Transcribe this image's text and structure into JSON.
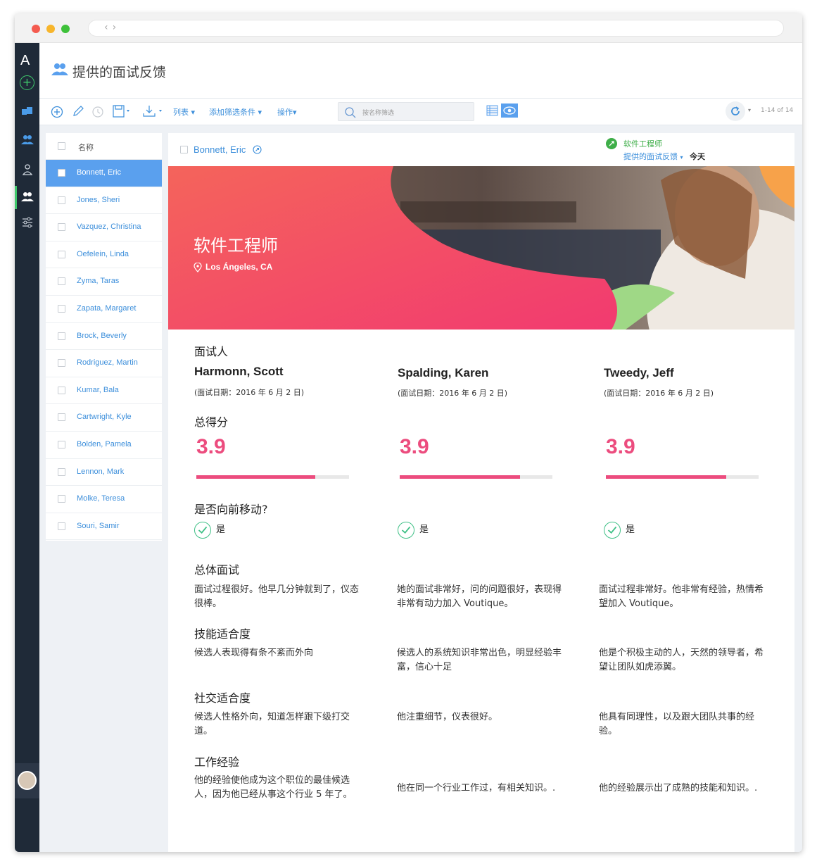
{
  "header": {
    "title": "提供的面试反馈"
  },
  "toolbar": {
    "list_label": "列表",
    "add_filter_label": "添加筛选条件",
    "actions_label": "操作",
    "search_placeholder": "按名称筛选",
    "pager": "1-14 of 14"
  },
  "list": {
    "header_label": "名称",
    "items": [
      "Bonnett, Eric",
      "Jones, Sheri",
      "Vazquez, Christina",
      "Oefelein, Linda",
      "Zyma, Taras",
      "Zapata, Margaret",
      "Brock, Beverly",
      "Rodriguez, Martin",
      "Kumar, Bala",
      "Cartwright, Kyle",
      "Bolden, Pamela",
      "Lennon, Mark",
      "Molke, Teresa",
      "Souri, Samir"
    ],
    "selected": "Bonnett, Eric"
  },
  "detail": {
    "candidate": "Bonnett, Eric",
    "job_link": "软件工程师",
    "feedback_link": "提供的面试反馈",
    "when": "今天",
    "banner_title": "软件工程师",
    "location": "Los Ángeles, CA",
    "section_interviewer": "面试人",
    "section_score": "总得分",
    "section_move": "是否向前移动?",
    "section_overall": "总体面试",
    "section_skills": "技能适合度",
    "section_social": "社交适合度",
    "section_experience": "工作经验",
    "interviewers": [
      {
        "name": "Harmonn, Scott",
        "date": "(面试日期：2016 年 6 月 2 日)",
        "score": "3.9",
        "score_fraction": 0.78,
        "move": "是",
        "overall": "面试过程很好。他早几分钟就到了，仪态很棒。",
        "skills": "候选人表现得有条不紊而外向",
        "social": "候选人性格外向，知道怎样跟下级打交道。",
        "experience": "他的经验使他成为这个职位的最佳候选人，因为他已经从事这个行业 5 年了。"
      },
      {
        "name": "Spalding, Karen",
        "date": "(面试日期：2016 年 6 月 2 日)",
        "score": "3.9",
        "score_fraction": 0.79,
        "move": "是",
        "overall": "她的面试非常好，问的问题很好，表现得非常有动力加入 Voutique。",
        "skills": "候选人的系统知识非常出色，明显经验丰富，信心十足",
        "social": "他注重细节，仪表很好。",
        "experience": "他在同一个行业工作过，有相关知识。."
      },
      {
        "name": "Tweedy, Jeff",
        "date": "(面试日期：2016 年 6 月 2 日)",
        "score": "3.9",
        "score_fraction": 0.79,
        "move": "是",
        "overall": "面试过程非常好。他非常有经验，热情希望加入 Voutique。",
        "skills": "他是个积极主动的人，天然的领导者，希望让团队如虎添翼。",
        "social": "他具有同理性，以及跟大团队共事的经验。",
        "experience": "他的经验展示出了成熟的技能和知识。."
      }
    ]
  },
  "colors": {
    "accent": "#3d8fdb",
    "score": "#ec4c7e",
    "green": "#3fc086",
    "sidebar": "#1f2a38"
  }
}
